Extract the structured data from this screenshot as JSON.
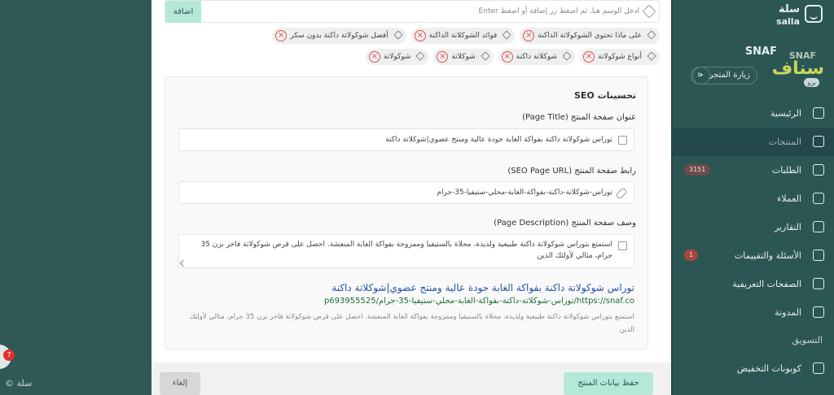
{
  "left_panel": {
    "chat_badge": "7",
    "footer_brand": "© سلة"
  },
  "sidebar": {
    "logo_text": "سلة",
    "logo_sub": "salla",
    "store_name": "SNAF",
    "store_logo_small": "SNAF",
    "store_logo_big": "سناف",
    "store_badge": "برو",
    "visit_store": "زيارة المتجر",
    "items": [
      {
        "label": "الرئيسية",
        "icon": "home-icon",
        "badge": ""
      },
      {
        "label": "المنتجات",
        "icon": "tag-icon",
        "badge": ""
      },
      {
        "label": "الطلبات",
        "icon": "cart-icon",
        "badge": "3151"
      },
      {
        "label": "العملاء",
        "icon": "users-icon",
        "badge": ""
      },
      {
        "label": "التقارير",
        "icon": "chart-icon",
        "badge": ""
      },
      {
        "label": "الأسئلة والتقييمات",
        "icon": "chat-icon",
        "badge": "1"
      },
      {
        "label": "الصفحات التعريفية",
        "icon": "page-icon",
        "badge": ""
      },
      {
        "label": "المدونة",
        "icon": "blog-icon",
        "badge": ""
      }
    ],
    "section_marketing": "التسويق",
    "coupons": "كوبونات التخفيض"
  },
  "tags": {
    "placeholder": "ادخل الوسم هنا، ثم اضغط زر إضافة أو اضغط Enter",
    "add_label": "اضافة",
    "row1": [
      "على ماذا تحتوي الشوكولاتة الداكنة",
      "فوائد الشوكلاتة الداكنة",
      "أفضل شوكولاتة داكنة بدون سكر"
    ],
    "row2": [
      "أنواع شوكولاتة",
      "شوكلاتة داكنة",
      "شوكلاتة",
      "شوكولاتة"
    ]
  },
  "seo": {
    "section_title": "تحسينات SEO",
    "page_title_label": "عنوان صفحة المنتج (Page Title)",
    "page_title_value": "توراس شوكولاتة داكنة بفواكة الغابة جودة عالية ومنتج عضوي|شوكلاتة داكنة",
    "url_label": "رابط صفحة المنتج (SEO Page URL)",
    "url_value": "توراس-شوكلاتة-داكنة-بفواكة-الغابة-محلي-ستيفيا-35-جرام",
    "desc_label": "وصف صفحة المنتج (Page Description)",
    "desc_value": "استمتع بتوراس شوكولاتة داكنة طبيعية ولذيذة، محلاة بالستيفيا وممزوجة بفواكة الغابة المنعشة. احصل على قرص شوكولاتة فاخر بزن 35 جرام، مثالي لأولئك الذين",
    "preview_title": "توراس شوكولاتة داكنة بفواكة الغابة جودة عالية ومنتج عضوي|شوكلاتة داكنة",
    "preview_url": "https://snaf.co/توراس-شوكلاتة-داكنة-بفواكة-الغابة-محلي-ستيفيا-35-جرام/p693955525",
    "preview_desc": "استمتع بتوراس شوكولاتة داكنة طبيعية ولذيذة، محلاة بالستيفيا وممزوجة بفواكة الغابة المنعشة. احصل على قرص شوكولاتة فاخر بزن 35 جرام، مثالي لأولئك الذين"
  },
  "footer": {
    "save_label": "حفظ بيانات المنتج",
    "cancel_label": "إلغاء"
  }
}
